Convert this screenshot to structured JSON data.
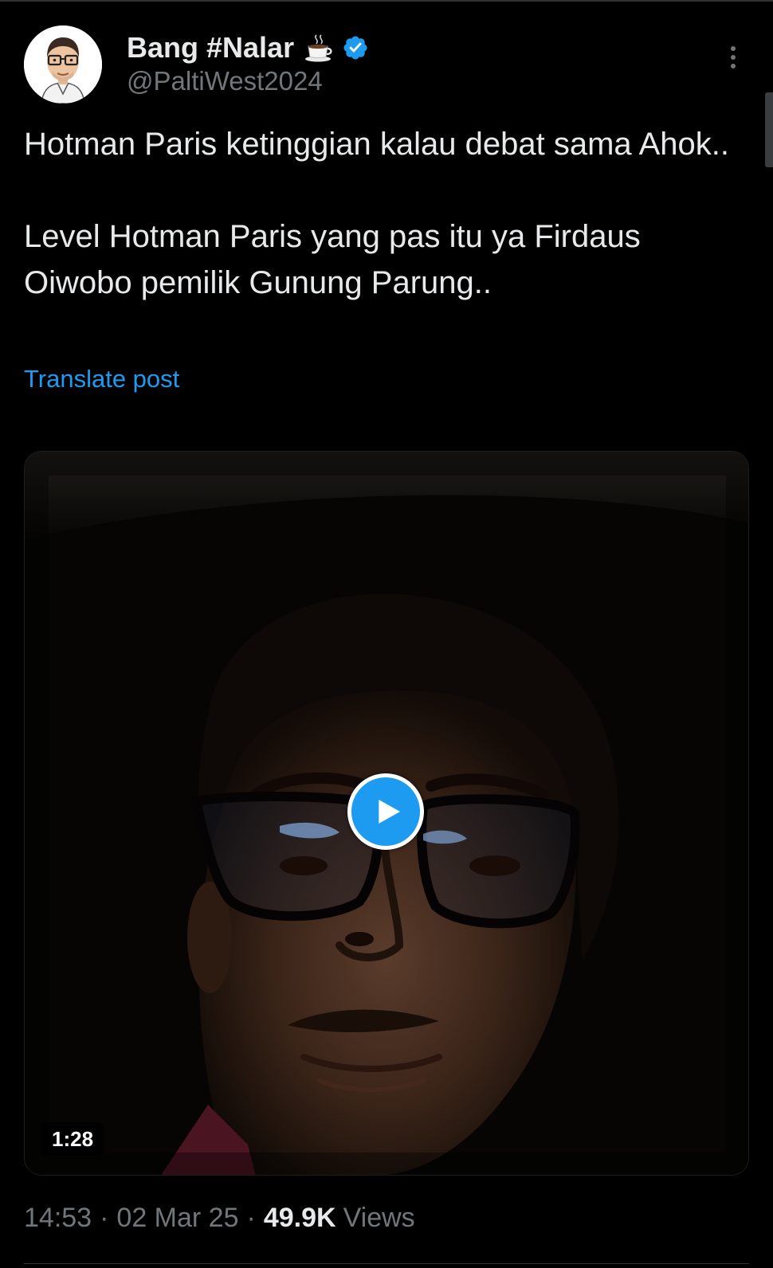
{
  "post": {
    "author": {
      "display_name": "Bang #Nalar",
      "name_emoji": "coffee-icon",
      "verified_badge": "verified-icon",
      "handle": "@PaltiWest2024"
    },
    "more_icon": "more-vertical-icon",
    "text": {
      "paragraph_1": "Hotman Paris ketinggian kalau debat sama Ahok..",
      "paragraph_2": "Level Hotman Paris yang pas itu ya Firdaus Oiwobo pemilik Gunung Parung.."
    },
    "translate_label": "Translate post",
    "video": {
      "duration": "1:28",
      "play_icon": "play-icon"
    },
    "meta": {
      "time": "14:53",
      "separator": "·",
      "date": "02 Mar 25",
      "views_count": "49.9K",
      "views_label": "Views"
    }
  },
  "colors": {
    "background": "#000000",
    "text_primary": "#e7e9ea",
    "text_secondary": "#71767b",
    "accent": "#1d9bf0",
    "divider": "#2f3336"
  }
}
